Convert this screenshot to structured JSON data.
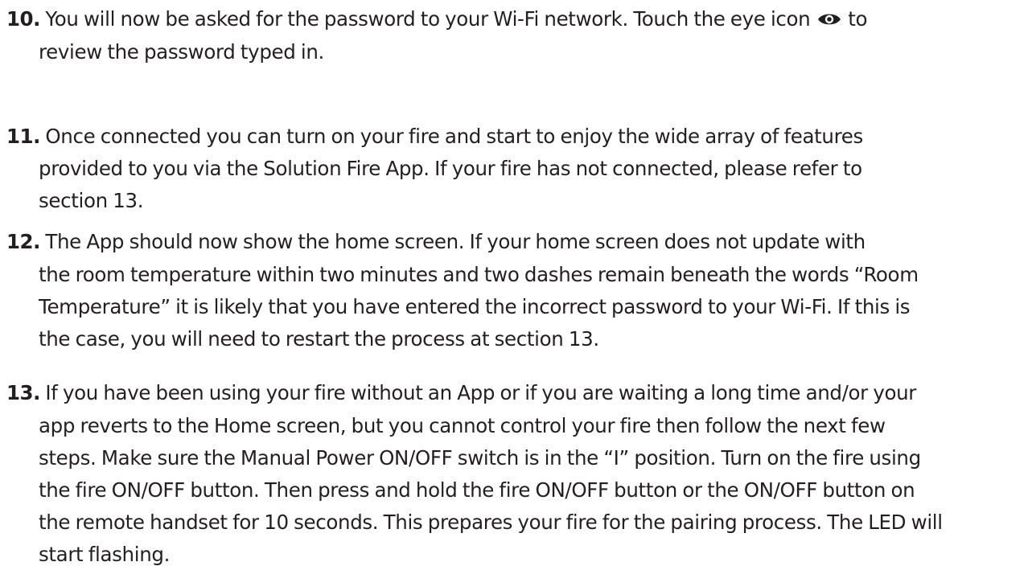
{
  "steps": [
    {
      "number": "10.",
      "lines": [
        {
          "before": "You will now be asked for the password to your Wi-Fi network. Touch the eye icon",
          "after": "to"
        },
        "review the password typed in."
      ],
      "icon": "eye-icon"
    },
    {
      "number": "11.",
      "lines": [
        "Once connected you can turn on your fire and start to enjoy the wide array of features",
        "provided to you via the Solution Fire App. If your fire has not connected, please refer to",
        "section 13."
      ]
    },
    {
      "number": "12.",
      "lines": [
        "The App should now show the home screen. If your home screen does not update with",
        "the room temperature within two minutes and two dashes remain beneath the words “Room",
        "Temperature” it is likely that you have entered the incorrect password to your Wi-Fi. If this is",
        "the case, you will need to restart the process at section 13."
      ]
    },
    {
      "number": "13.",
      "lines": [
        "If you have been using your fire without an App or if you are waiting a long time and/or your",
        "app reverts to the Home screen, but you cannot control your fire then follow the next few",
        "steps. Make sure the Manual Power ON/OFF switch is in the “I” position. Turn on the fire using",
        "the fire ON/OFF button. Then press and hold the fire ON/OFF button or the ON/OFF button on",
        "the remote handset for 10 seconds. This prepares your fire for the pairing process. The LED will",
        "start flashing."
      ]
    }
  ]
}
